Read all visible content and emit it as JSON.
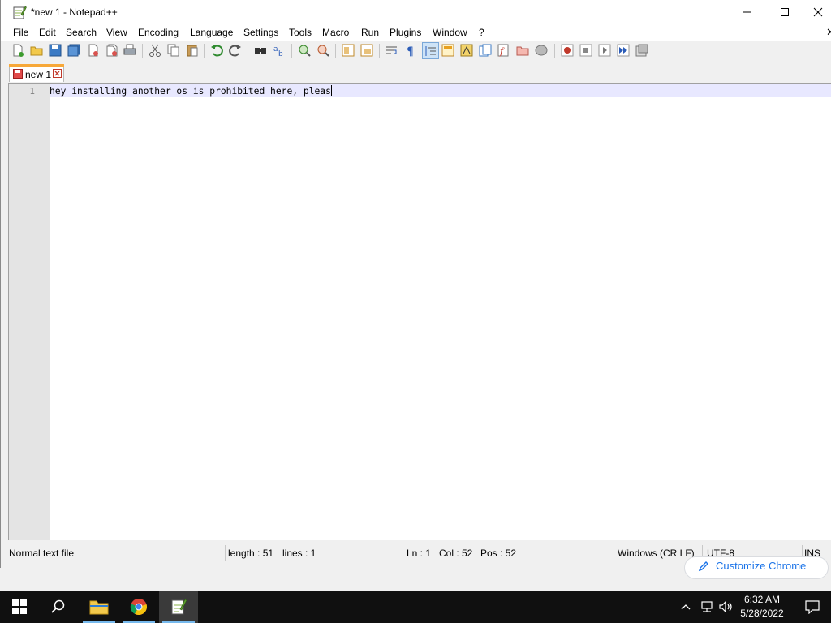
{
  "window": {
    "title": "*new 1 - Notepad++"
  },
  "menu": {
    "items": [
      "File",
      "Edit",
      "Search",
      "View",
      "Encoding",
      "Language",
      "Settings",
      "Tools",
      "Macro",
      "Run",
      "Plugins",
      "Window",
      "?"
    ],
    "close_glyph": "✕"
  },
  "tabs": [
    {
      "label": "new 1",
      "modified": true
    }
  ],
  "editor": {
    "line_number": "1",
    "text": "hey installing another os is prohibited here, pleas"
  },
  "status": {
    "file_type": "Normal text file",
    "length": "length : 51",
    "lines": "lines : 1",
    "ln": "Ln : 1",
    "col": "Col : 52",
    "pos": "Pos : 52",
    "eol": "Windows (CR LF)",
    "encoding": "UTF-8",
    "mode": "INS"
  },
  "background_app": {
    "customize_label": "Customize Chrome"
  },
  "taskbar": {
    "apps": [
      "start-icon",
      "search-icon",
      "file-explorer-icon",
      "chrome-icon",
      "notepadpp-icon"
    ],
    "time": "6:32 AM",
    "date": "5/28/2022"
  },
  "colors": {
    "current_line": "#e8e8ff",
    "tab_accent": "#f7a839",
    "chrome_link": "#1a73e8",
    "taskbar": "#101010"
  }
}
